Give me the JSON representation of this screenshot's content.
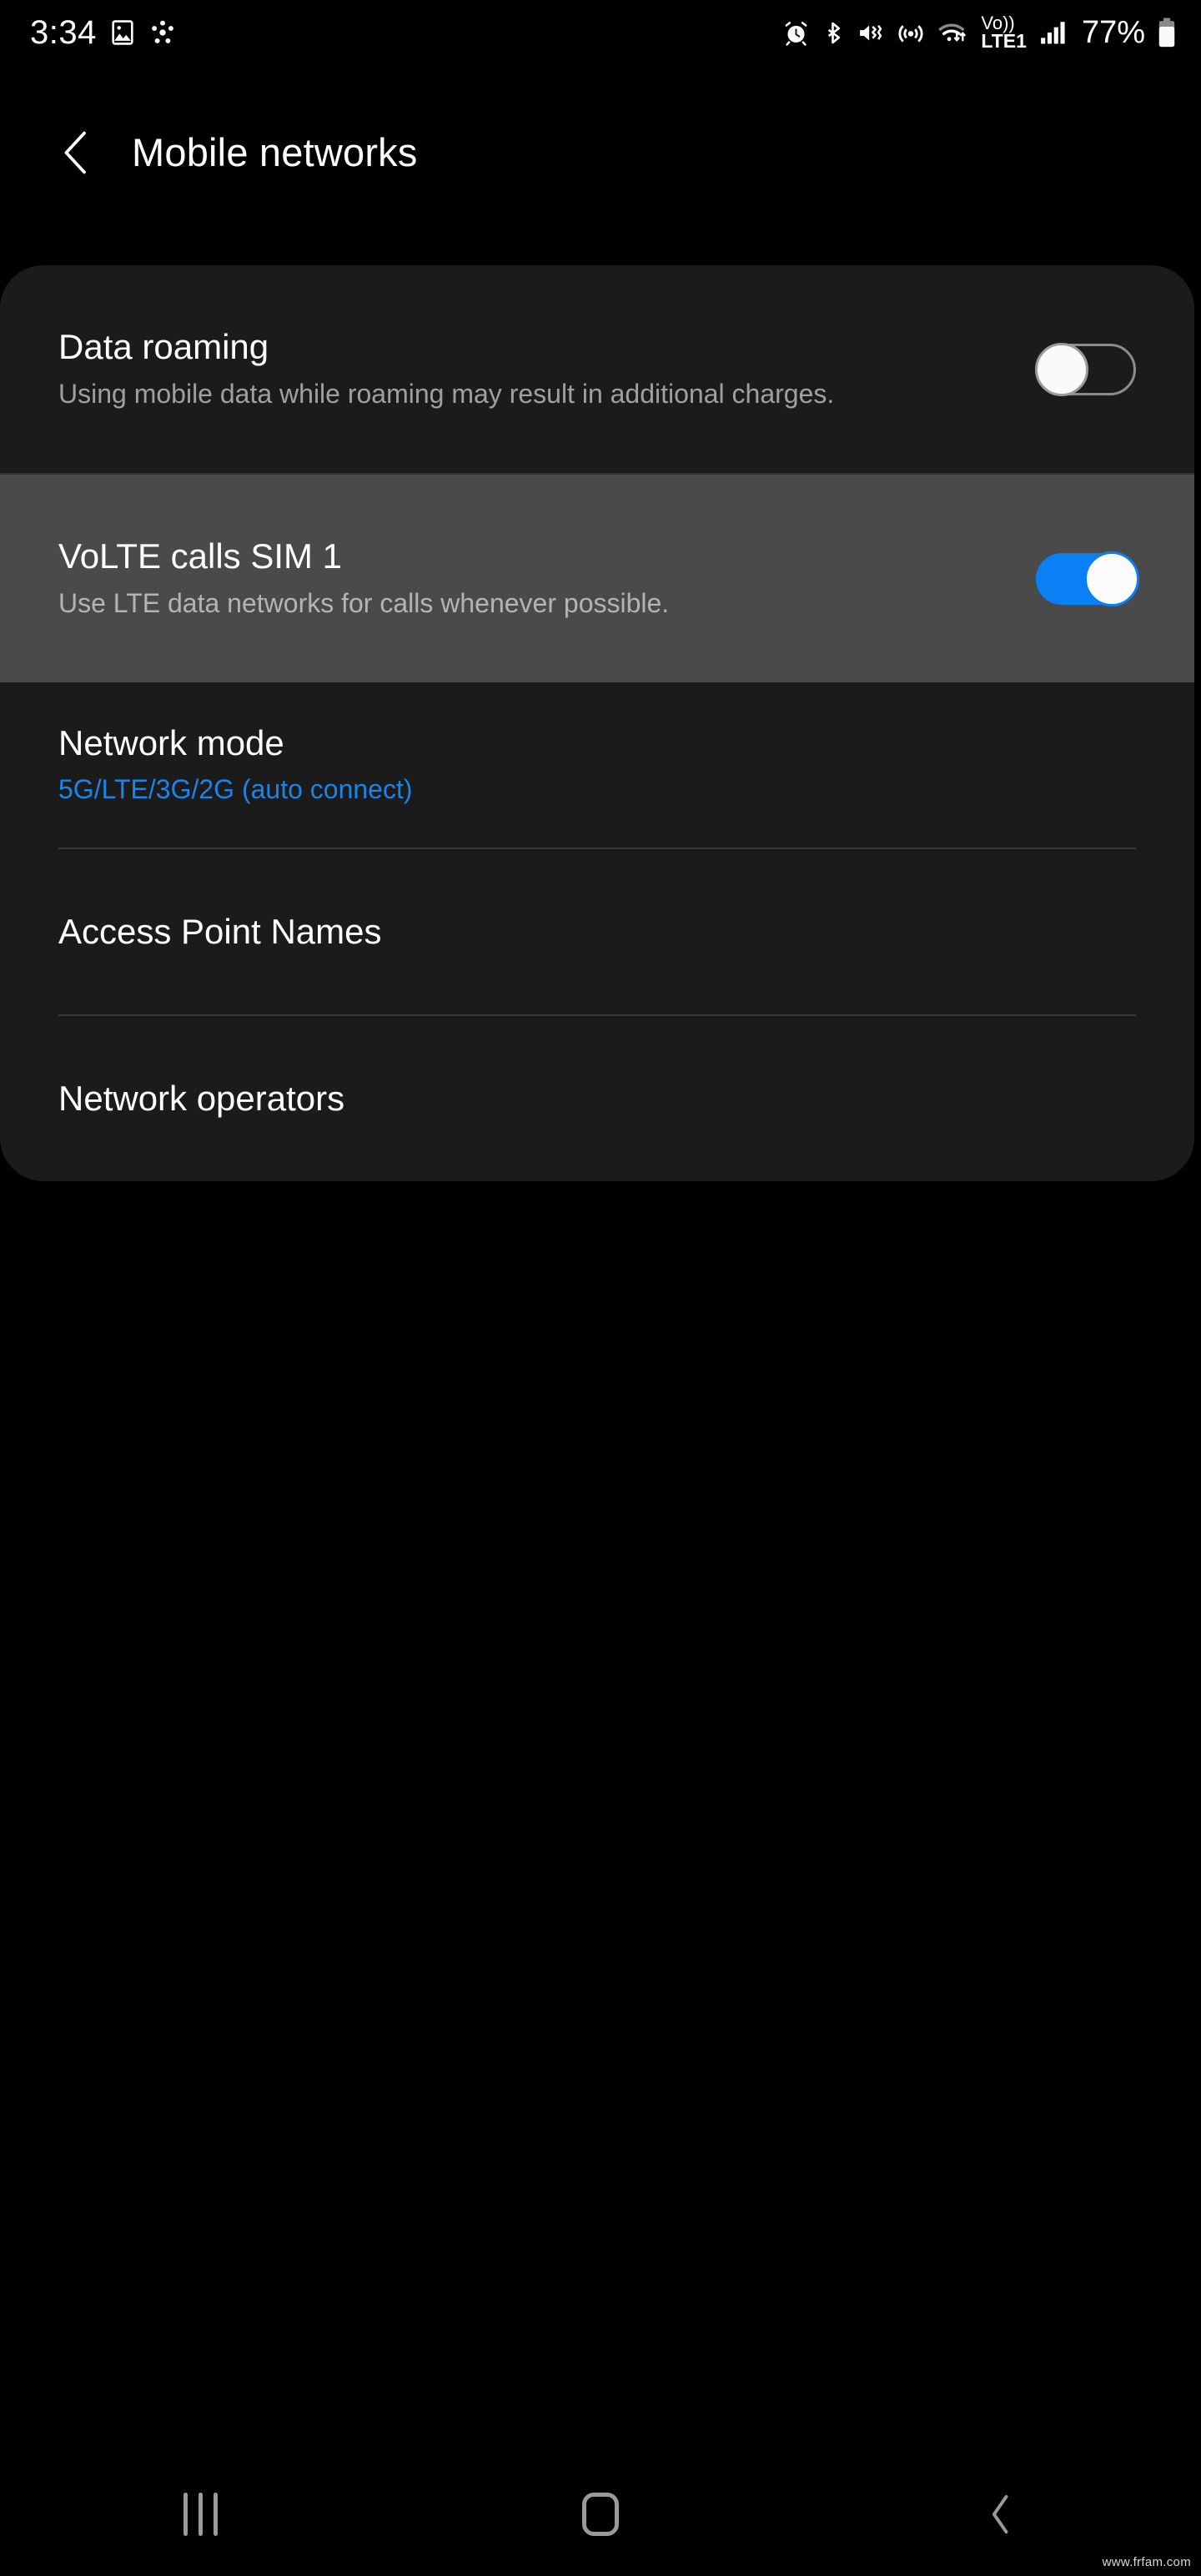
{
  "status_bar": {
    "clock": "3:34",
    "left_icons": [
      "image-icon",
      "network-share-icon"
    ],
    "right_icons": [
      "alarm-icon",
      "bluetooth-icon",
      "mute-vibrate-icon",
      "hotspot-icon",
      "wifi-data-icon",
      "volte-icon",
      "signal-bars-icon"
    ],
    "volte_label_top": "Vo))",
    "volte_label_bottom": "LTE1",
    "battery_percent": "77%"
  },
  "header": {
    "title": "Mobile networks",
    "back_icon": "chevron-left-icon"
  },
  "settings": {
    "items": [
      {
        "type": "switch",
        "title": "Data roaming",
        "summary": "Using mobile data while roaming may result in additional charges.",
        "switch_state": "off",
        "highlighted": false
      },
      {
        "type": "switch",
        "title": "VoLTE calls SIM 1",
        "summary": "Use LTE data networks for calls whenever possible.",
        "switch_state": "on",
        "highlighted": true
      },
      {
        "type": "nav",
        "title": "Network mode",
        "summary": "5G/LTE/3G/2G (auto connect)",
        "summary_color": "#1a84e8"
      },
      {
        "type": "nav",
        "title": "Access Point Names",
        "summary": ""
      },
      {
        "type": "nav",
        "title": "Network operators",
        "summary": ""
      }
    ]
  },
  "nav_bar": {
    "recents_label": "recents-icon",
    "home_label": "home-icon",
    "back_label": "back-icon"
  },
  "watermark": "www.frfam.com",
  "colors": {
    "accent_blue": "#0a80f5",
    "link_blue": "#1a84e8",
    "card_bg": "#1b1b1b",
    "highlight_bg": "#4a4a4a",
    "page_bg": "#000000"
  }
}
